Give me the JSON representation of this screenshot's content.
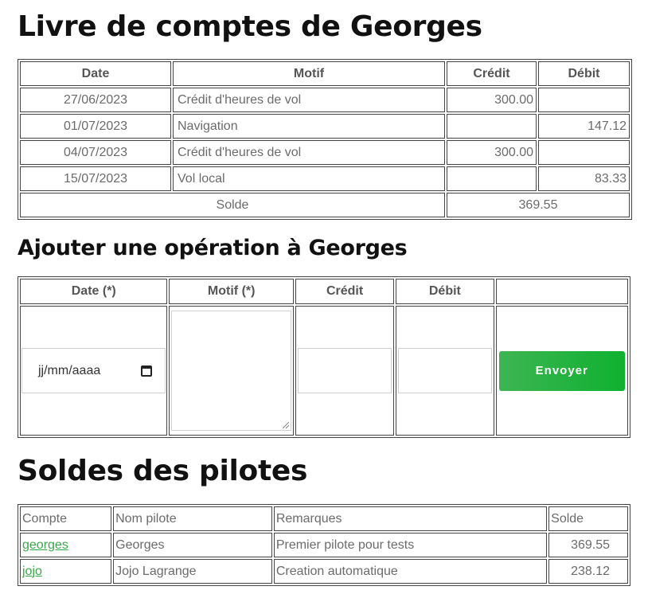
{
  "ledger": {
    "title": "Livre de comptes de Georges",
    "headers": {
      "date": "Date",
      "motif": "Motif",
      "credit": "Crédit",
      "debit": "Débit"
    },
    "rows": [
      {
        "date": "27/06/2023",
        "motif": "Crédit d'heures de vol",
        "credit": "300.00",
        "debit": ""
      },
      {
        "date": "01/07/2023",
        "motif": "Navigation",
        "credit": "",
        "debit": "147.12"
      },
      {
        "date": "04/07/2023",
        "motif": "Crédit d'heures de vol",
        "credit": "300.00",
        "debit": ""
      },
      {
        "date": "15/07/2023",
        "motif": "Vol local",
        "credit": "",
        "debit": "83.33"
      }
    ],
    "balance_label": "Solde",
    "balance_value": "369.55"
  },
  "form": {
    "title": "Ajouter une opération à Georges",
    "headers": {
      "date": "Date (*)",
      "motif": "Motif (*)",
      "credit": "Crédit",
      "debit": "Débit"
    },
    "date_placeholder": "jj/mm/aaaa",
    "motif_value": "",
    "credit_value": "",
    "debit_value": "",
    "submit_label": "Envoyer",
    "submit_color": "#1db43c"
  },
  "pilots": {
    "title": "Soldes des pilotes",
    "headers": {
      "account": "Compte",
      "name": "Nom pilote",
      "remarks": "Remarques",
      "balance": "Solde"
    },
    "rows": [
      {
        "account": "georges",
        "name": "Georges",
        "remarks": "Premier pilote pour tests",
        "balance": "369.55"
      },
      {
        "account": "jojo",
        "name": "Jojo Lagrange",
        "remarks": "Creation automatique",
        "balance": "238.12"
      }
    ],
    "link_color": "#3aa84a"
  }
}
